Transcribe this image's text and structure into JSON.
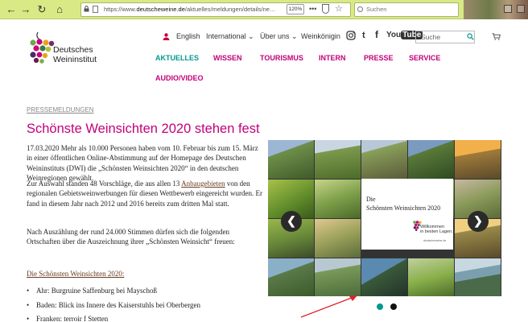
{
  "browser": {
    "url_prefix": "https://www.",
    "url_domain": "deutscheweine.de",
    "url_path": "/aktuelles/meldungen/details/ne…",
    "zoom": "120%",
    "search_placeholder": "Suchen",
    "dots": "•••"
  },
  "logo": {
    "line1": "Deutsches",
    "line2": "Weininstitut"
  },
  "util": {
    "english": "English",
    "international": "International ⌄",
    "ueber_uns": "Über uns ⌄",
    "weinkoenigin": "Weinkönigin",
    "youtube_you": "You",
    "youtube_tube": "Tube",
    "search_placeholder": "Suche",
    "twitter_glyph": "t",
    "facebook_glyph": "f"
  },
  "nav": {
    "aktuelles": "AKTUELLES",
    "wissen": "WISSEN",
    "tourismus": "TOURISMUS",
    "intern": "INTERN",
    "presse": "PRESSE",
    "service": "SERVICE",
    "audio_video": "AUDIO/VIDEO"
  },
  "colors": {
    "teal": "#009a8e",
    "magenta": "#c2007a",
    "chrome": "#d8e986"
  },
  "article": {
    "breadcrumb": "PRESSEMELDUNGEN",
    "title": "Schönste Weinsichten 2020 stehen fest",
    "p1": "17.03.2020 Mehr als 10.000 Personen haben vom 10. Februar bis zum 15. März in einer öffentlichen Online-Abstimmung auf der Homepage des Deutschen Weininstituts (DWI) die „Schönsten Weinsichten 2020“ in den deutschen Weinregionen gewählt.",
    "p2_before": "Zur Auswahl standen 48 Vorschläge, die aus allen 13 ",
    "p2_link": "Anbaugebieten",
    "p2_after": " von den regionalen Gebietsweinwerbungen für diesen Wettbewerb eingereicht wurden. Er fand in diesem Jahr nach 2012 und 2016 bereits zum dritten Mal statt.",
    "p3": "Nach Auszählung der rund 24.000 Stimmen dürfen sich die folgenden Ortschaften über die Auszeichnung ihrer „Schönsten Weinsicht“ freuen:",
    "sublink": "Die Schönsten Weinsichten 2020:",
    "bullets": [
      "Ahr: Burgruine Saffenburg bei Mayschoß",
      "Baden: Blick ins Innere des Kaiserstuhls bei Oberbergen",
      "Franken: terroir f Stetten"
    ]
  },
  "slider": {
    "card_line1": "Die",
    "card_line2": "Schönsten Weinsichten 2020",
    "card_small1": "Willkommen",
    "card_small2": "in besten Lagen.",
    "card_url": "deutscheweine.de",
    "prev": "❮",
    "next": "❯",
    "slide_count": 2,
    "active_slide": 1
  }
}
